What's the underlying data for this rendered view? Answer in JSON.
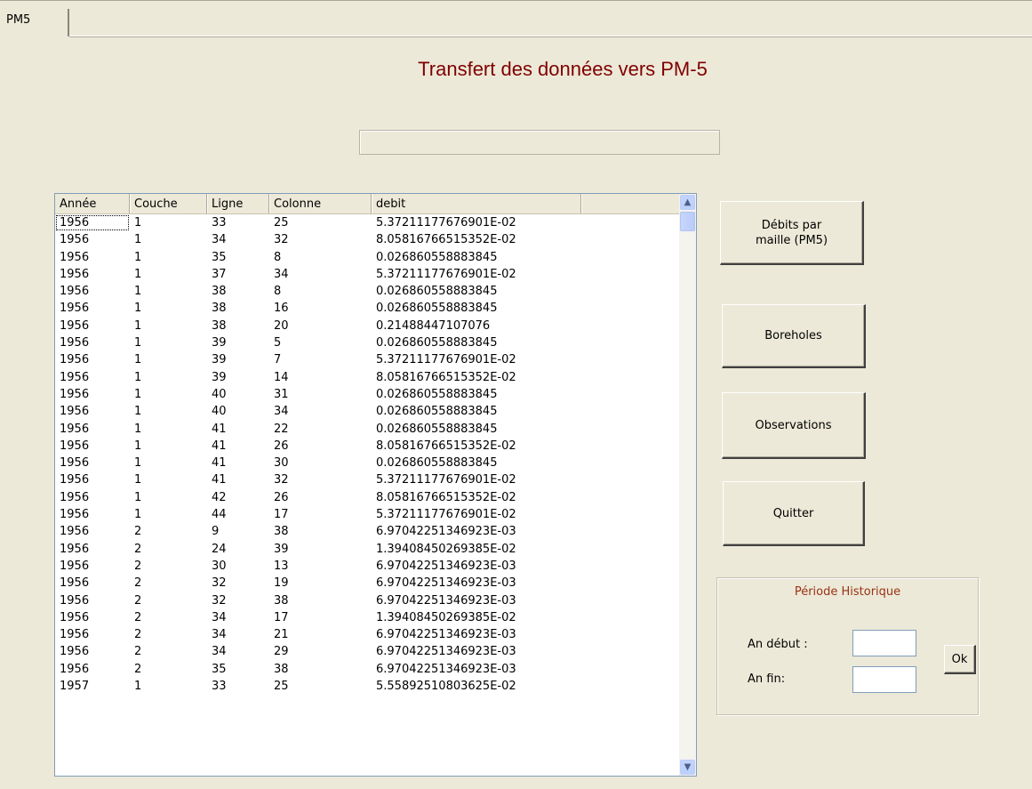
{
  "tab": {
    "label": "PM5"
  },
  "title": "Transfert des données vers PM-5",
  "table": {
    "columns": [
      "Année",
      "Couche",
      "Ligne",
      "Colonne",
      "debit",
      ""
    ],
    "rows": [
      [
        "1956",
        "1",
        "33",
        "25",
        "5.37211177676901E-02"
      ],
      [
        "1956",
        "1",
        "34",
        "32",
        "8.05816766515352E-02"
      ],
      [
        "1956",
        "1",
        "35",
        "8",
        "0.026860558883845"
      ],
      [
        "1956",
        "1",
        "37",
        "34",
        "5.37211177676901E-02"
      ],
      [
        "1956",
        "1",
        "38",
        "8",
        "0.026860558883845"
      ],
      [
        "1956",
        "1",
        "38",
        "16",
        "0.026860558883845"
      ],
      [
        "1956",
        "1",
        "38",
        "20",
        "0.21488447107076"
      ],
      [
        "1956",
        "1",
        "39",
        "5",
        "0.026860558883845"
      ],
      [
        "1956",
        "1",
        "39",
        "7",
        "5.37211177676901E-02"
      ],
      [
        "1956",
        "1",
        "39",
        "14",
        "8.05816766515352E-02"
      ],
      [
        "1956",
        "1",
        "40",
        "31",
        "0.026860558883845"
      ],
      [
        "1956",
        "1",
        "40",
        "34",
        "0.026860558883845"
      ],
      [
        "1956",
        "1",
        "41",
        "22",
        "0.026860558883845"
      ],
      [
        "1956",
        "1",
        "41",
        "26",
        "8.05816766515352E-02"
      ],
      [
        "1956",
        "1",
        "41",
        "30",
        "0.026860558883845"
      ],
      [
        "1956",
        "1",
        "41",
        "32",
        "5.37211177676901E-02"
      ],
      [
        "1956",
        "1",
        "42",
        "26",
        "8.05816766515352E-02"
      ],
      [
        "1956",
        "1",
        "44",
        "17",
        "5.37211177676901E-02"
      ],
      [
        "1956",
        "2",
        "9",
        "38",
        "6.97042251346923E-03"
      ],
      [
        "1956",
        "2",
        "24",
        "39",
        "1.39408450269385E-02"
      ],
      [
        "1956",
        "2",
        "30",
        "13",
        "6.97042251346923E-03"
      ],
      [
        "1956",
        "2",
        "32",
        "19",
        "6.97042251346923E-03"
      ],
      [
        "1956",
        "2",
        "32",
        "38",
        "6.97042251346923E-03"
      ],
      [
        "1956",
        "2",
        "34",
        "17",
        "1.39408450269385E-02"
      ],
      [
        "1956",
        "2",
        "34",
        "21",
        "6.97042251346923E-03"
      ],
      [
        "1956",
        "2",
        "34",
        "29",
        "6.97042251346923E-03"
      ],
      [
        "1956",
        "2",
        "35",
        "38",
        "6.97042251346923E-03"
      ],
      [
        "1957",
        "1",
        "33",
        "25",
        "5.55892510803625E-02"
      ]
    ]
  },
  "buttons": {
    "debits": "Débits par maille (PM5)",
    "boreholes": "Boreholes",
    "observations": "Observations",
    "quitter": "Quitter",
    "ok": "Ok"
  },
  "period": {
    "title": "Période Historique",
    "start_label": "An début :",
    "end_label": "An fin:",
    "start_value": "",
    "end_value": ""
  },
  "icons": {
    "scroll_up": "scroll-up-arrow",
    "scroll_down": "scroll-down-arrow"
  }
}
